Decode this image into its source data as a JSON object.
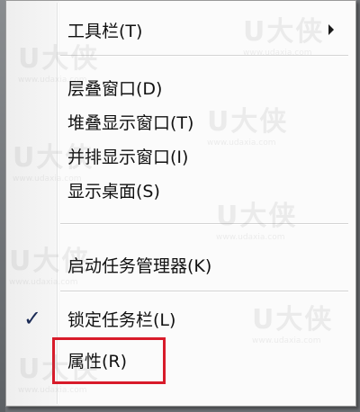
{
  "context_menu": {
    "items": [
      {
        "label": "工具栏(T)",
        "has_submenu": true
      },
      {
        "label": "层叠窗口(D)"
      },
      {
        "label": "堆叠显示窗口(T)"
      },
      {
        "label": "并排显示窗口(I)"
      },
      {
        "label": "显示桌面(S)"
      },
      {
        "label": "启动任务管理器(K)"
      },
      {
        "label": "锁定任务栏(L)",
        "checked": true
      },
      {
        "label": "属性(R)",
        "highlighted": true
      }
    ],
    "check_mark": "✓",
    "highlight_color": "#d81b2a"
  },
  "watermark": {
    "text": "U大侠",
    "subtext": "www.udaxia.com"
  }
}
